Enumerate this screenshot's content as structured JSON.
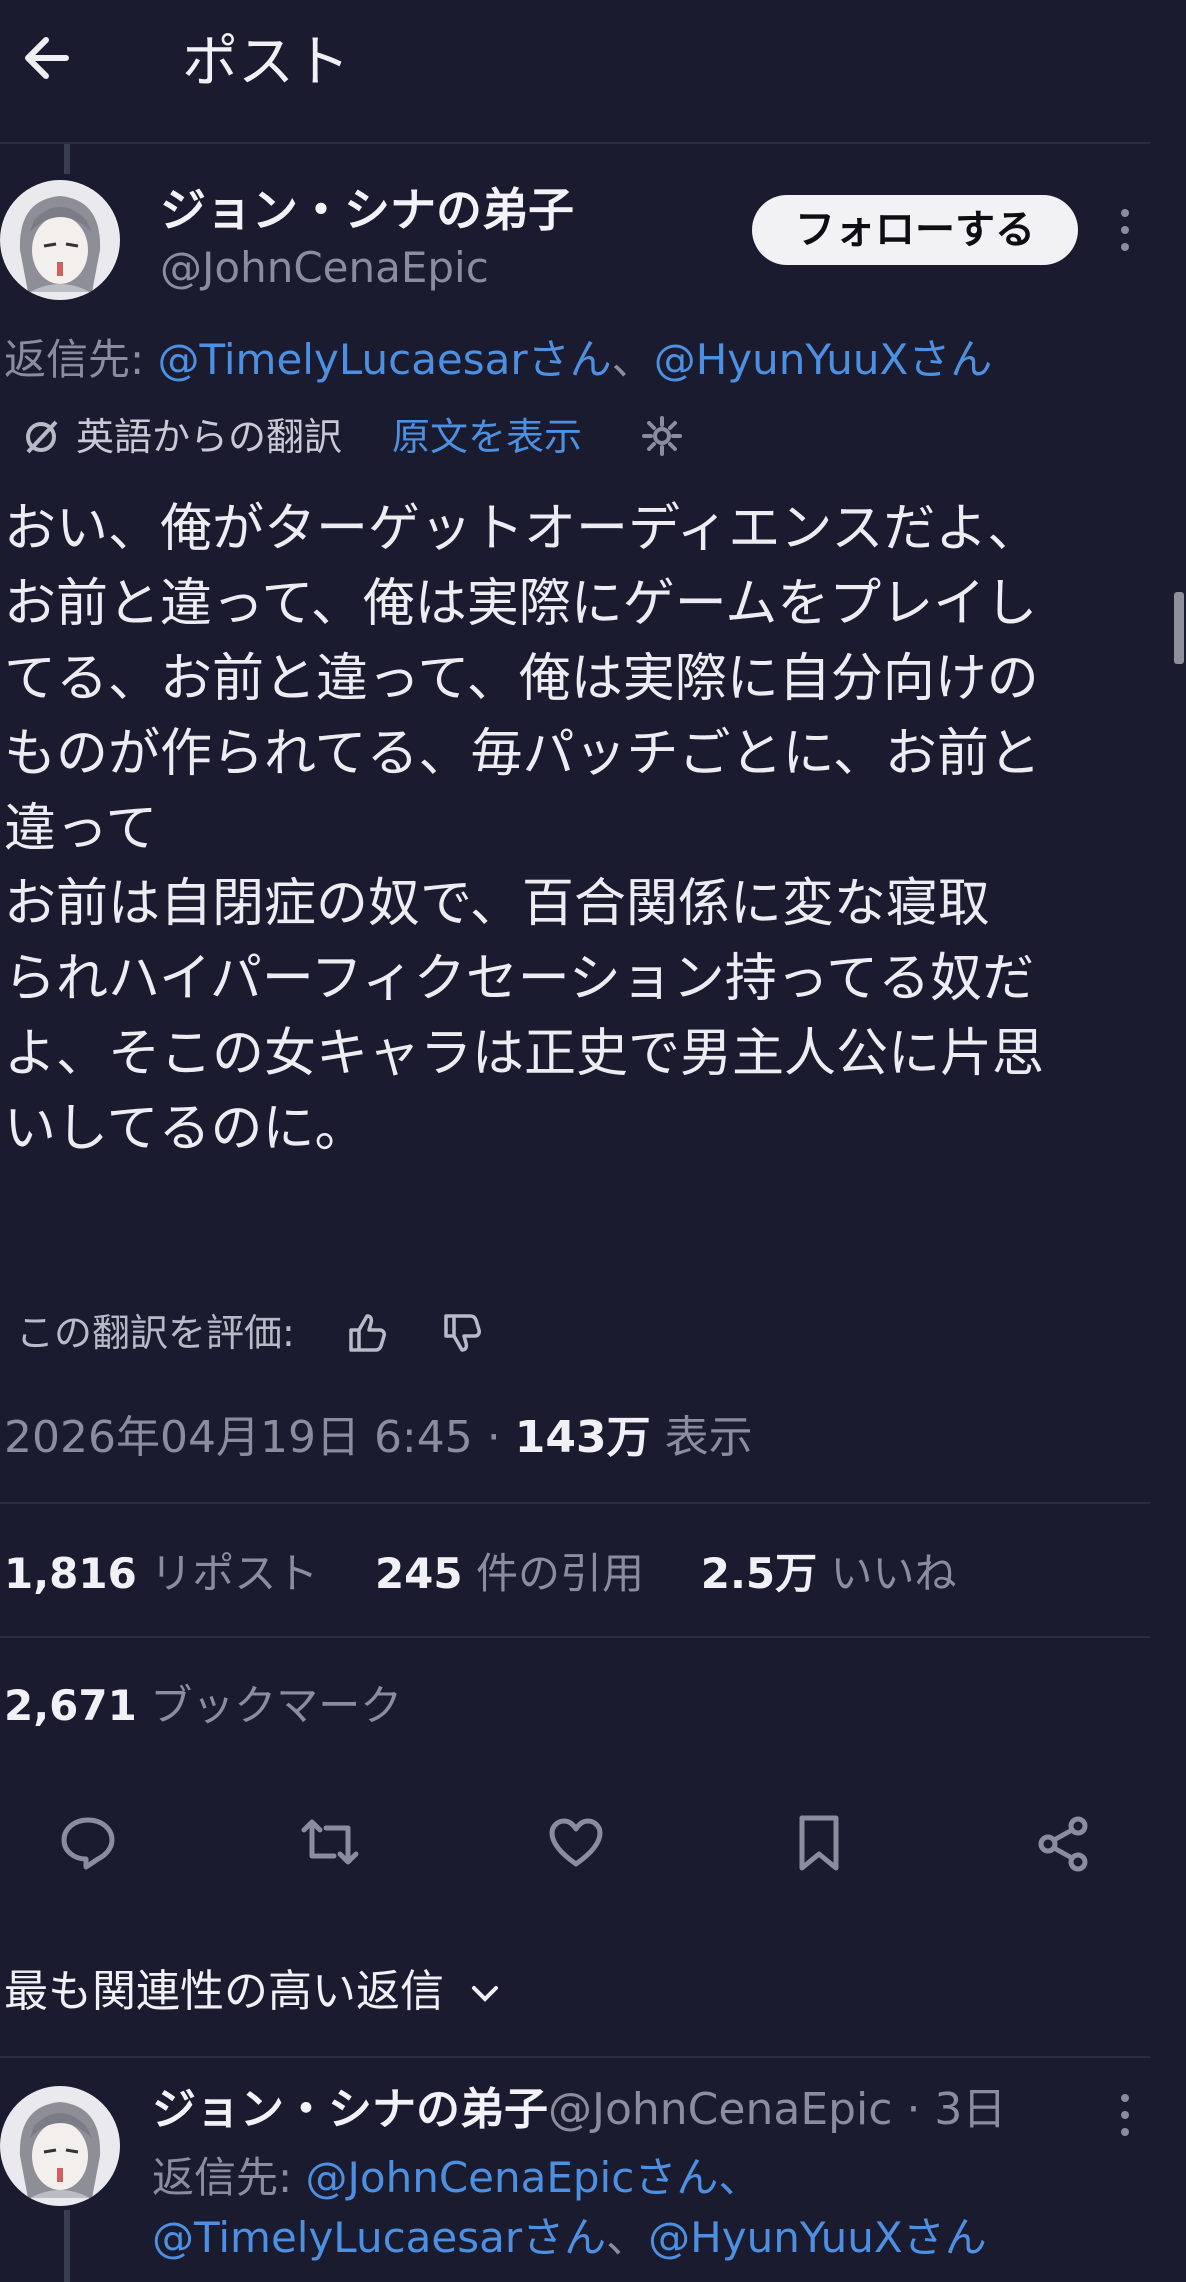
{
  "header": {
    "title": "ポスト"
  },
  "post": {
    "author_name": "ジョン・シナの弟子",
    "author_handle": "@JohnCenaEpic",
    "follow_label": "フォローする",
    "reply_to_prefix": "返信先: ",
    "reply_to_user1": "@TimelyLucaesarさん",
    "reply_sep": "、",
    "reply_to_user2": "@HyunYuuXさん",
    "translation_label": "英語からの翻訳",
    "show_original": "原文を表示",
    "body_lines": [
      "おい、俺がターゲットオーディエンスだよ、",
      "お前と違って、俺は実際にゲームをプレイし",
      "てる、お前と違って、俺は実際に自分向けの",
      "ものが作られてる、毎パッチごとに、お前と",
      "違って",
      "お前は自閉症の奴で、百合関係に変な寝取",
      "られハイパーフィクセーション持ってる奴だ",
      "よ、そこの女キャラは正史で男主人公に片思",
      "いしてるのに。"
    ],
    "rate_translation": "この翻訳を評価:",
    "timestamp": "2026年04月19日 6:45",
    "dot": " · ",
    "views_count": "143万",
    "views_label": "表示"
  },
  "stats": {
    "reposts_count": "1,816",
    "reposts_label": "リポスト",
    "quotes_count": "245",
    "quotes_label": "件の引用",
    "likes_count": "2.5万",
    "likes_label": "いいね",
    "bookmarks_count": "2,671",
    "bookmarks_label": "ブックマーク"
  },
  "sort": {
    "label": "最も関連性の高い返信"
  },
  "reply": {
    "author_name": "ジョン・シナの弟子",
    "author_handle": "@JohnCenaEpic",
    "meta": " · 3日",
    "reply_to_prefix": "返信先: ",
    "reply_to_user1": "@JohnCenaEpicさん、",
    "reply_to_user2": "@TimelyLucaesarさん",
    "reply_sep": "、",
    "reply_to_user3": "@HyunYuuXさん"
  },
  "colors": {
    "background": "#1a1b2e",
    "link": "#4d8fe0",
    "muted": "#8b8d9e"
  }
}
